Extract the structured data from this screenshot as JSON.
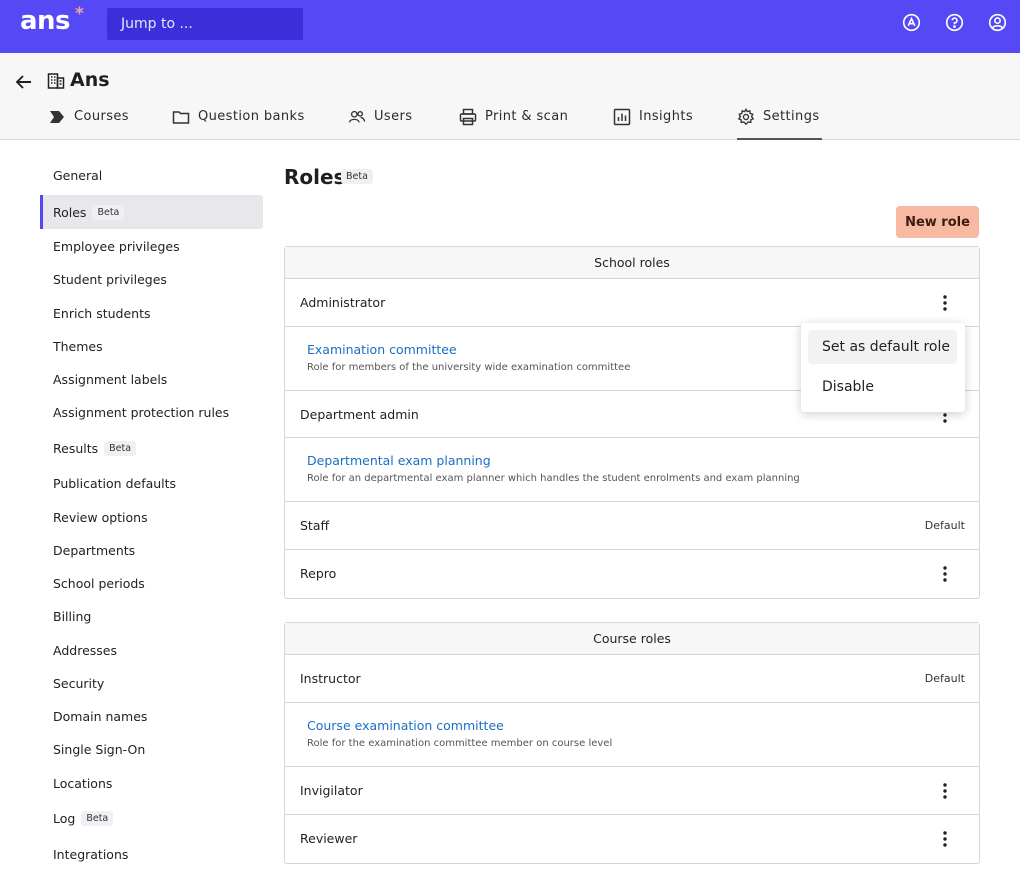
{
  "app": {
    "logo": "ans",
    "logo_mark": "*",
    "jump_placeholder": "Jump to ...",
    "accent": "#5548f5"
  },
  "header": {
    "org_name": "Ans",
    "tabs": [
      {
        "label": "Courses",
        "icon": "courses-icon"
      },
      {
        "label": "Question banks",
        "icon": "folder-icon"
      },
      {
        "label": "Users",
        "icon": "users-icon"
      },
      {
        "label": "Print & scan",
        "icon": "printer-icon"
      },
      {
        "label": "Insights",
        "icon": "chart-icon"
      },
      {
        "label": "Settings",
        "icon": "gear-icon",
        "active": true
      }
    ]
  },
  "sidebar": {
    "items": [
      {
        "label": "General"
      },
      {
        "label": "Roles",
        "badge": "Beta",
        "active": true
      },
      {
        "label": "Employee privileges"
      },
      {
        "label": "Student privileges"
      },
      {
        "label": "Enrich students"
      },
      {
        "label": "Themes"
      },
      {
        "label": "Assignment labels"
      },
      {
        "label": "Assignment protection rules"
      },
      {
        "label": "Results",
        "badge": "Beta"
      },
      {
        "label": "Publication defaults"
      },
      {
        "label": "Review options"
      },
      {
        "label": "Departments"
      },
      {
        "label": "School periods"
      },
      {
        "label": "Billing"
      },
      {
        "label": "Addresses"
      },
      {
        "label": "Security"
      },
      {
        "label": "Domain names"
      },
      {
        "label": "Single Sign-On"
      },
      {
        "label": "Locations"
      },
      {
        "label": "Log",
        "badge": "Beta"
      },
      {
        "label": "Integrations"
      }
    ]
  },
  "main": {
    "title": "Roles",
    "title_badge": "Beta",
    "new_role_label": "New role",
    "school_roles": {
      "heading": "School roles",
      "administrator": "Administrator",
      "exam_committee_name": "Examination committee",
      "exam_committee_desc": "Role for members of the university wide examination committee",
      "department_admin": "Department admin",
      "dept_exam_name": "Departmental exam planning",
      "dept_exam_desc": "Role for an departmental exam planner which handles the student enrolments and exam planning",
      "staff": "Staff",
      "staff_tag": "Default",
      "repro": "Repro"
    },
    "course_roles": {
      "heading": "Course roles",
      "instructor": "Instructor",
      "instructor_tag": "Default",
      "course_exam_name": "Course examination committee",
      "course_exam_desc": "Role for the examination committee member on course level",
      "invigilator": "Invigilator",
      "reviewer": "Reviewer"
    }
  },
  "menu": {
    "set_default": "Set as default role",
    "disable": "Disable"
  }
}
